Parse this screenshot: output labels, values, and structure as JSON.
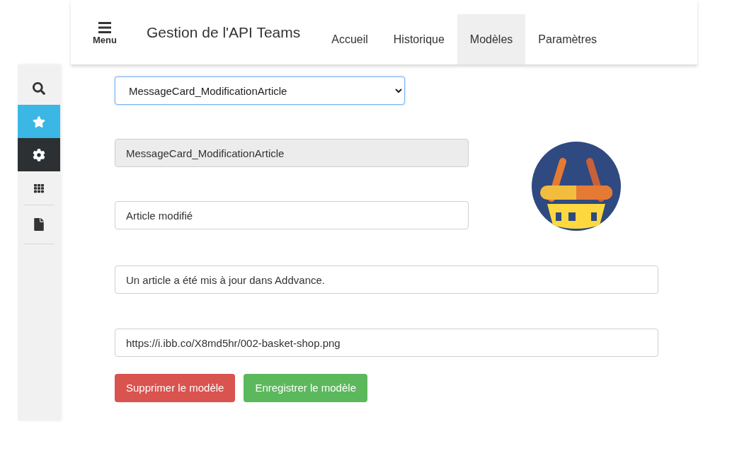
{
  "header": {
    "menu_label": "Menu",
    "title": "Gestion de l'API Teams",
    "tabs": [
      {
        "label": "Accueil",
        "selected": false
      },
      {
        "label": "Historique",
        "selected": false
      },
      {
        "label": "Modèles",
        "selected": true
      },
      {
        "label": "Paramètres",
        "selected": false
      }
    ]
  },
  "sidebar": {
    "items": [
      {
        "kind": "search"
      },
      {
        "kind": "star",
        "color": "#3bb7e5"
      },
      {
        "kind": "gear",
        "color": "#2d3033"
      },
      {
        "kind": "grid"
      },
      {
        "kind": "file"
      }
    ]
  },
  "form": {
    "template_select": {
      "value": "MessageCard_ModificationArticle"
    },
    "name_field": {
      "value": "MessageCard_ModificationArticle",
      "disabled": true
    },
    "title_field": {
      "value": "Article modifié",
      "disabled": false
    },
    "text_field": {
      "value": "Un article a été mis à jour dans Addvance.",
      "disabled": false
    },
    "image_field": {
      "value": "https://i.ibb.co/X8md5hr/002-basket-shop.png",
      "disabled": false
    },
    "buttons": [
      {
        "label": "Supprimer le modèle",
        "kind": "danger"
      },
      {
        "label": "Enregistrer le modèle",
        "kind": "success"
      }
    ]
  }
}
